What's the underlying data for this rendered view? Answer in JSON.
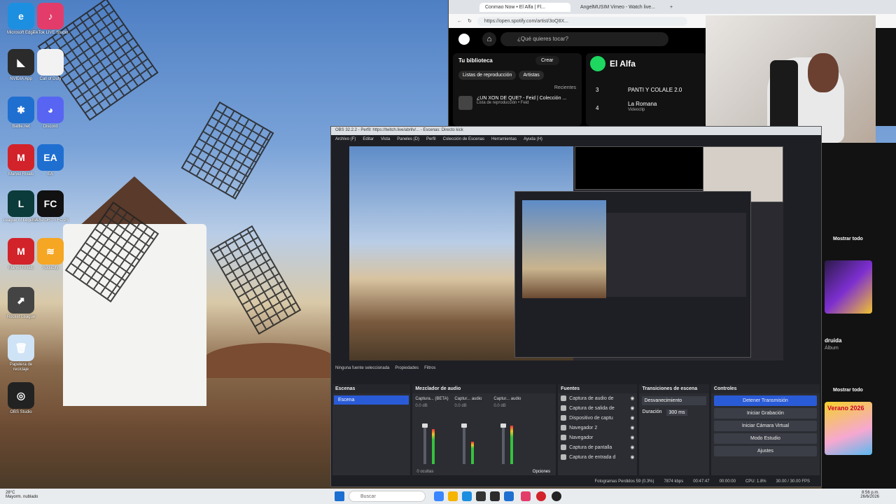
{
  "desktop": {
    "icons": [
      {
        "label": "Microsoft Edge",
        "glyph": "e",
        "color": "#1d8fe0"
      },
      {
        "label": "TikTok LIVE Studio",
        "glyph": "♪",
        "color": "#e33c6a"
      },
      {
        "label": "NVIDIA App",
        "glyph": "◣",
        "color": "#2b2b2b"
      },
      {
        "label": "Call of Duty",
        "glyph": "",
        "color": "#f2f2f2"
      },
      {
        "label": "Battle.net",
        "glyph": "✱",
        "color": "#1f6fd1"
      },
      {
        "label": "Discord",
        "glyph": "◕",
        "color": "#5865f2"
      },
      {
        "label": "Marvel Rivals",
        "glyph": "M",
        "color": "#d2232a"
      },
      {
        "label": "EA",
        "glyph": "EA",
        "color": "#1f6fd1"
      },
      {
        "label": "League of Legends",
        "glyph": "L",
        "color": "#0b3b3a"
      },
      {
        "label": "EA SPORTS FC 25",
        "glyph": "FC",
        "color": "#111"
      },
      {
        "label": "Marvel Rivals",
        "glyph": "M",
        "color": "#d2232a"
      },
      {
        "label": "Audacity",
        "glyph": "≋",
        "color": "#f5a623"
      },
      {
        "label": "Rocket League",
        "glyph": "⬈",
        "color": "#444"
      },
      {
        "label": "Papelera de reciclaje",
        "glyph": "🗑",
        "color": "#cfe3f7"
      },
      {
        "label": "OBS Studio",
        "glyph": "◎",
        "color": "#222"
      }
    ]
  },
  "browser": {
    "tabs": [
      "Conmao Now • El Alfa | Fl...",
      "AngelMUSIM Vimeo - Watch live..."
    ],
    "url": "https://open.spotify.com/artist/3oQ8X...",
    "spotify": {
      "search_placeholder": "¿Qué quieres tocar?",
      "library_title": "Tu biblioteca",
      "create_label": "Crear",
      "chips": [
        "Listas de reproducción",
        "Artistas"
      ],
      "recent_label": "Recientes",
      "playlist_title": "¿UN XON DE QUE? - Feid | Colección ...",
      "playlist_sub": "Lista de reproducción • Feid",
      "artist_name": "El Alfa",
      "tracks": [
        {
          "num": "3",
          "title": "PANTI Y COLALE 2.0"
        },
        {
          "num": "4",
          "title": "La Romana",
          "sub": "Videoclip"
        }
      ]
    }
  },
  "obs": {
    "title": "OBS 32.2.2 - Perfil: https://twitch.live/abrilv/... - Escenas: Directo kick",
    "menu": [
      "Archivo (F)",
      "Editar",
      "Vista",
      "Paneles (D)",
      "Perfil",
      "Colección de Escenas",
      "Herramientas",
      "Ayuda (H)"
    ],
    "no_source": "Ninguna fuente seleccionada",
    "properties": "Propiedades",
    "filters": "Filtros",
    "scenes": {
      "title": "Escenas",
      "items": [
        "Escena"
      ]
    },
    "mixer": {
      "title": "Mezclador de audio",
      "channels": [
        {
          "name": "Captura... (BETA)",
          "level": 0.72,
          "db": "0.0 dB"
        },
        {
          "name": "Captur... audio",
          "level": 0.45,
          "db": "0.0 dB"
        },
        {
          "name": "Captur... audio",
          "level": 0.78,
          "db": "0.0 dB"
        }
      ],
      "hidden": "0 ocultas",
      "options": "Opciones"
    },
    "sources": {
      "title": "Fuentes",
      "items": [
        "Captura de audio de",
        "Captura de salida de",
        "Dispositivo de captu",
        "Navegador 2",
        "Navegador",
        "Captura de pantalla",
        "Captura de entrada d"
      ]
    },
    "transitions": {
      "title": "Transiciones de escena",
      "type": "Desvanecimiento",
      "duration_label": "Duración",
      "duration": "300 ms"
    },
    "controls": {
      "title": "Controles",
      "buttons": [
        "Detener Transmisión",
        "Iniciar Grabación",
        "Iniciar Cámara Virtual",
        "Modo Estudio",
        "Ajustes"
      ]
    },
    "status": {
      "dropped": "Fotogramas Perdidos 59 (0.3%)",
      "kbps": "7874 kbps",
      "time_live": "00:47:47",
      "time_rec": "00:00:00",
      "cpu": "CPU: 1.8%",
      "fps": "30.00 / 30.00 FPS"
    }
  },
  "spotify_right": {
    "see_all_1": "Mostrar todo",
    "album1_title": "druida",
    "album1_sub": "Álbum",
    "see_all_2": "Mostrar todo",
    "album2_tag": "Verano 2026"
  },
  "taskbar": {
    "weather_temp": "28°C",
    "weather_desc": "Mayorm. nublado",
    "search_placeholder": "Buscar",
    "time": "8:56 p.m.",
    "date": "26/6/2026"
  }
}
